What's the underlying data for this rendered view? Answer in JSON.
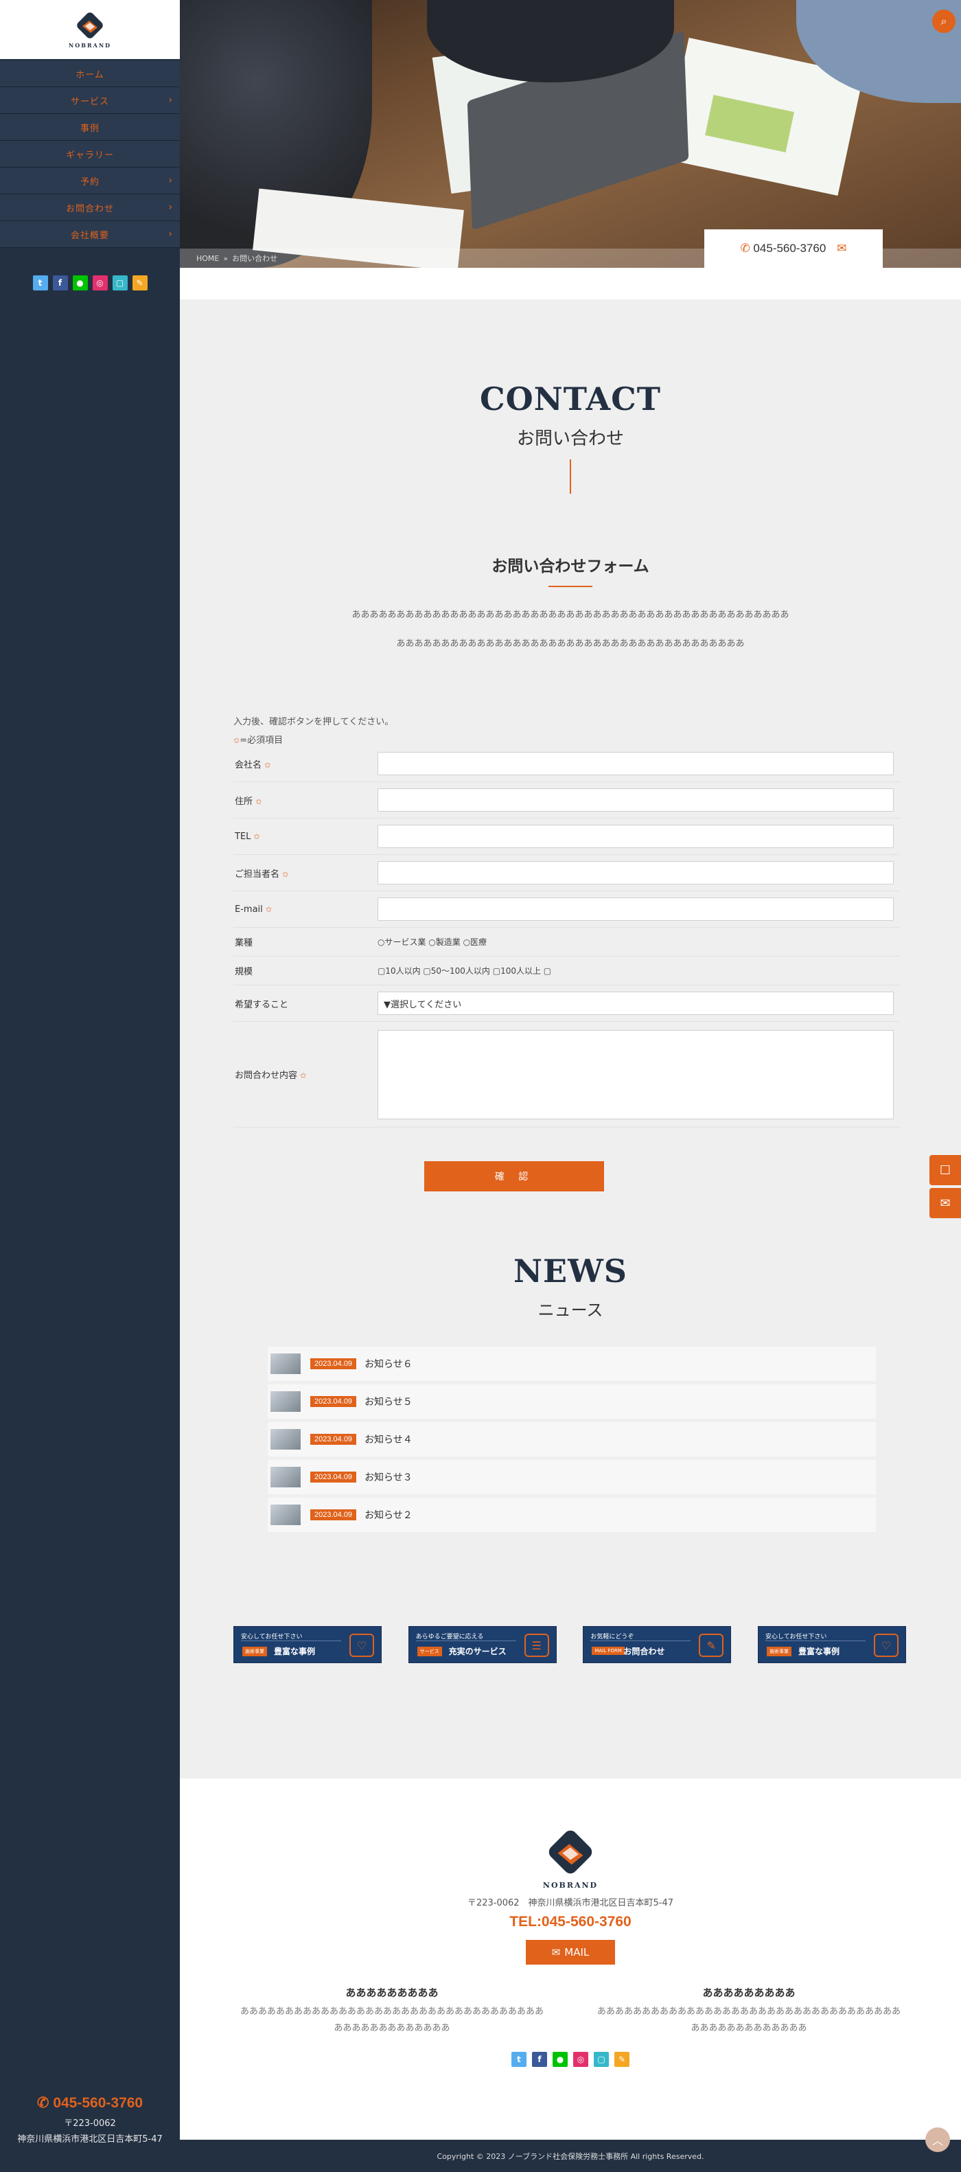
{
  "logo": {
    "text": "NOBRAND"
  },
  "nav": [
    {
      "label": "ホーム",
      "has_sub": false
    },
    {
      "label": "サービス",
      "has_sub": true
    },
    {
      "label": "事例",
      "has_sub": false
    },
    {
      "label": "ギャラリー",
      "has_sub": false
    },
    {
      "label": "予約",
      "has_sub": true
    },
    {
      "label": "お問合わせ",
      "has_sub": true
    },
    {
      "label": "会社概要",
      "has_sub": true
    }
  ],
  "social_icons": [
    "twitter-icon",
    "facebook-icon",
    "line-icon",
    "instagram-icon",
    "b-icon",
    "note-icon"
  ],
  "sidebar_bottom": {
    "tel": "045-560-3760",
    "zip": "〒223-0062",
    "address": "神奈川県横浜市港北区日吉本町5-47"
  },
  "hero": {
    "tel": "045-560-3760"
  },
  "breadcrumb": {
    "home": "HOME",
    "sep": "»",
    "current": "お問い合わせ"
  },
  "contact": {
    "title": "CONTACT",
    "subtitle": "お問い合わせ"
  },
  "form": {
    "heading": "お問い合わせフォーム",
    "lead_line1": "あああああああああああああああああああああああああああああああああああああああああああああああああ",
    "lead_line2": "あああああああああああああああああああああああああああああああああああああああ",
    "note": "入力後、確認ボタンを押してください。",
    "required_note": "=必須項目",
    "fields": {
      "company": "会社名",
      "address": "住所",
      "tel": "TEL",
      "person": "ご担当者名",
      "email": "E-mail",
      "industry": "業種",
      "scale": "規模",
      "request": "希望すること",
      "message": "お問合わせ内容"
    },
    "industry_options": "○サービス業 ○製造業 ○医療",
    "scale_options": "▢10人以内 ▢50〜100人以内 ▢100人以上 ▢",
    "select_placeholder": "▼選択してください",
    "confirm": "確 認"
  },
  "news": {
    "title": "NEWS",
    "subtitle": "ニュース",
    "items": [
      {
        "date": "2023.04.09",
        "title": "お知らせ６"
      },
      {
        "date": "2023.04.09",
        "title": "お知らせ５"
      },
      {
        "date": "2023.04.09",
        "title": "お知らせ４"
      },
      {
        "date": "2023.04.09",
        "title": "お知らせ３"
      },
      {
        "date": "2023.04.09",
        "title": "お知らせ２"
      }
    ]
  },
  "banners": [
    {
      "top": "安心してお任せ下さい",
      "tag": "施術事業",
      "main": "豊富な事例",
      "icon": "handshake-icon"
    },
    {
      "top": "あらゆるご要望に応える",
      "tag": "サービス",
      "main": "充実のサービス",
      "icon": "clipboard-icon"
    },
    {
      "top": "お気軽にどうぞ",
      "tag": "MAIL FORM",
      "main": "お問合わせ",
      "icon": "pen-icon"
    },
    {
      "top": "安心してお任せ下さい",
      "tag": "施術事業",
      "main": "豊富な事例",
      "icon": "handshake-icon"
    }
  ],
  "footer": {
    "address": "〒223-0062　神奈川県横浜市港北区日吉本町5-47",
    "tel": "TEL:045-560-3760",
    "mail": "MAIL",
    "col1_title": "あああああああああ",
    "col1_text": "あああああああああああああああああああああああああああああああああああああああああああああああ",
    "col2_title": "あああああああああ",
    "col2_text": "あああああああああああああああああああああああああああああああああああああああああああああああ",
    "copyright": "Copyright © 2023 ノーブランド社会保険労務士事務所 All rights Reserved."
  },
  "colors": {
    "accent": "#e0621b",
    "navy": "#233042"
  }
}
